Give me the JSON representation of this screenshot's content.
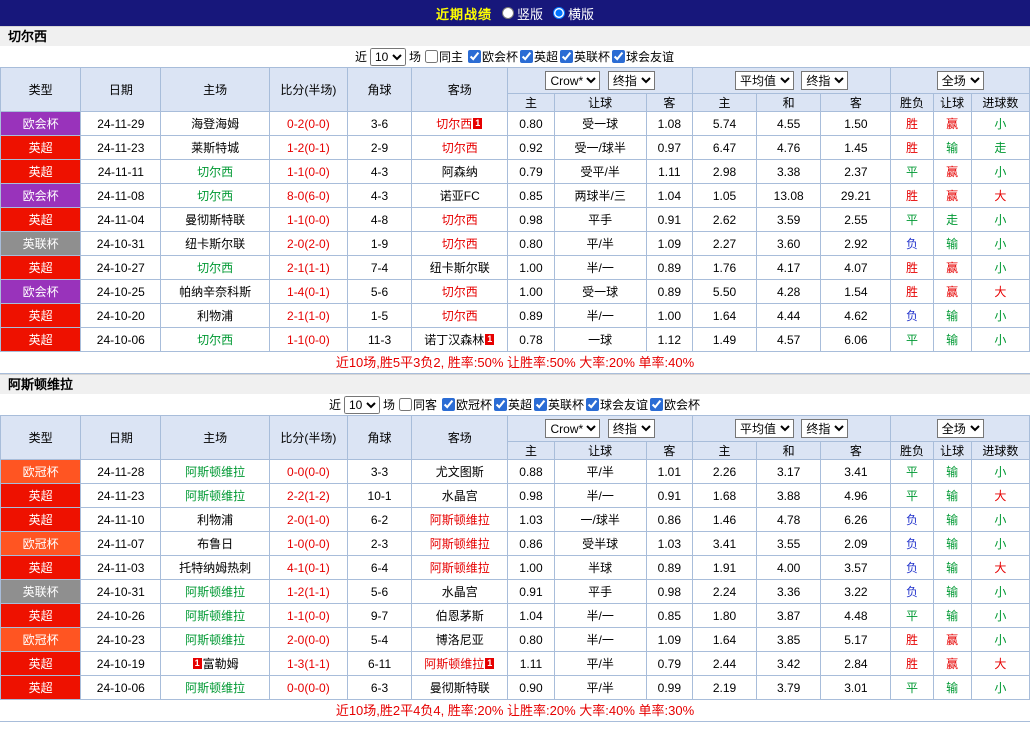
{
  "topbar": {
    "title": "近期战绩",
    "options": [
      {
        "label": "竖版",
        "checked": false
      },
      {
        "label": "横版",
        "checked": true
      }
    ]
  },
  "headers": {
    "type": "类型",
    "date": "日期",
    "home": "主场",
    "score": "比分(半场)",
    "corner": "角球",
    "away": "客场",
    "sub": [
      "主",
      "让球",
      "客",
      "主",
      "和",
      "客",
      "胜负",
      "让球",
      "进球数"
    ],
    "sel_crown": "Crow*",
    "sel_final": "终指",
    "sel_avg": "平均值",
    "sel_final2": "终指",
    "sel_full": "全场"
  },
  "colors": {
    "focus_home": "#009933",
    "focus_away": "#e60000",
    "score": "#e60000",
    "type_colors": {
      "欧会杯": "#9933bb",
      "英超": "#ee1100",
      "英联杯": "#8f8f8f",
      "欧冠杯": "#ff5522"
    },
    "result_colors": {
      "胜": "#e60000",
      "赢": "#e60000",
      "大": "#e60000",
      "平": "#009933",
      "输": "#009933",
      "小": "#009933",
      "走": "#009933",
      "负": "#2233cc"
    }
  },
  "sections": [
    {
      "team": "切尔西",
      "filter": {
        "near": "近",
        "count": "10",
        "games": "场",
        "same": {
          "label": "同主",
          "checked": false
        },
        "leagues": [
          {
            "label": "欧会杯",
            "checked": true
          },
          {
            "label": "英超",
            "checked": true
          },
          {
            "label": "英联杯",
            "checked": true
          },
          {
            "label": "球会友谊",
            "checked": true
          }
        ]
      },
      "rows": [
        {
          "type": "欧会杯",
          "date": "24-11-29",
          "home": "海登海姆",
          "homeMark": "",
          "homeBadge": "",
          "homeBadgePre": "",
          "score": "0-2(0-0)",
          "corner": "3-6",
          "away": "切尔西",
          "awayMark": "away",
          "awayBadge": "1",
          "awayBadgePre": "",
          "o1": "0.80",
          "line": "受一球",
          "o2": "1.08",
          "a1": "5.74",
          "a2": "4.55",
          "a3": "1.50",
          "r1": "胜",
          "r2": "赢",
          "r3": "小"
        },
        {
          "type": "英超",
          "date": "24-11-23",
          "home": "莱斯特城",
          "homeMark": "",
          "homeBadge": "",
          "homeBadgePre": "",
          "score": "1-2(0-1)",
          "corner": "2-9",
          "away": "切尔西",
          "awayMark": "away",
          "awayBadge": "",
          "awayBadgePre": "",
          "o1": "0.92",
          "line": "受一/球半",
          "o2": "0.97",
          "a1": "6.47",
          "a2": "4.76",
          "a3": "1.45",
          "r1": "胜",
          "r2": "输",
          "r3": "走"
        },
        {
          "type": "英超",
          "date": "24-11-11",
          "home": "切尔西",
          "homeMark": "home",
          "homeBadge": "",
          "homeBadgePre": "",
          "score": "1-1(0-0)",
          "corner": "4-3",
          "away": "阿森纳",
          "awayMark": "",
          "awayBadge": "",
          "awayBadgePre": "",
          "o1": "0.79",
          "line": "受平/半",
          "o2": "1.11",
          "a1": "2.98",
          "a2": "3.38",
          "a3": "2.37",
          "r1": "平",
          "r2": "赢",
          "r3": "小"
        },
        {
          "type": "欧会杯",
          "date": "24-11-08",
          "home": "切尔西",
          "homeMark": "home",
          "homeBadge": "",
          "homeBadgePre": "",
          "score": "8-0(6-0)",
          "corner": "4-3",
          "away": "诺亚FC",
          "awayMark": "",
          "awayBadge": "",
          "awayBadgePre": "",
          "o1": "0.85",
          "line": "两球半/三",
          "o2": "1.04",
          "a1": "1.05",
          "a2": "13.08",
          "a3": "29.21",
          "r1": "胜",
          "r2": "赢",
          "r3": "大"
        },
        {
          "type": "英超",
          "date": "24-11-04",
          "home": "曼彻斯特联",
          "homeMark": "",
          "homeBadge": "",
          "homeBadgePre": "",
          "score": "1-1(0-0)",
          "corner": "4-8",
          "away": "切尔西",
          "awayMark": "away",
          "awayBadge": "",
          "awayBadgePre": "",
          "o1": "0.98",
          "line": "平手",
          "o2": "0.91",
          "a1": "2.62",
          "a2": "3.59",
          "a3": "2.55",
          "r1": "平",
          "r2": "走",
          "r3": "小"
        },
        {
          "type": "英联杯",
          "date": "24-10-31",
          "home": "纽卡斯尔联",
          "homeMark": "",
          "homeBadge": "",
          "homeBadgePre": "",
          "score": "2-0(2-0)",
          "corner": "1-9",
          "away": "切尔西",
          "awayMark": "away",
          "awayBadge": "",
          "awayBadgePre": "",
          "o1": "0.80",
          "line": "平/半",
          "o2": "1.09",
          "a1": "2.27",
          "a2": "3.60",
          "a3": "2.92",
          "r1": "负",
          "r2": "输",
          "r3": "小"
        },
        {
          "type": "英超",
          "date": "24-10-27",
          "home": "切尔西",
          "homeMark": "home",
          "homeBadge": "",
          "homeBadgePre": "",
          "score": "2-1(1-1)",
          "corner": "7-4",
          "away": "纽卡斯尔联",
          "awayMark": "",
          "awayBadge": "",
          "awayBadgePre": "",
          "o1": "1.00",
          "line": "半/一",
          "o2": "0.89",
          "a1": "1.76",
          "a2": "4.17",
          "a3": "4.07",
          "r1": "胜",
          "r2": "赢",
          "r3": "小"
        },
        {
          "type": "欧会杯",
          "date": "24-10-25",
          "home": "帕纳辛奈科斯",
          "homeMark": "",
          "homeBadge": "",
          "homeBadgePre": "",
          "score": "1-4(0-1)",
          "corner": "5-6",
          "away": "切尔西",
          "awayMark": "away",
          "awayBadge": "",
          "awayBadgePre": "",
          "o1": "1.00",
          "line": "受一球",
          "o2": "0.89",
          "a1": "5.50",
          "a2": "4.28",
          "a3": "1.54",
          "r1": "胜",
          "r2": "赢",
          "r3": "大"
        },
        {
          "type": "英超",
          "date": "24-10-20",
          "home": "利物浦",
          "homeMark": "",
          "homeBadge": "",
          "homeBadgePre": "",
          "score": "2-1(1-0)",
          "corner": "1-5",
          "away": "切尔西",
          "awayMark": "away",
          "awayBadge": "",
          "awayBadgePre": "",
          "o1": "0.89",
          "line": "半/一",
          "o2": "1.00",
          "a1": "1.64",
          "a2": "4.44",
          "a3": "4.62",
          "r1": "负",
          "r2": "输",
          "r3": "小"
        },
        {
          "type": "英超",
          "date": "24-10-06",
          "home": "切尔西",
          "homeMark": "home",
          "homeBadge": "",
          "homeBadgePre": "",
          "score": "1-1(0-0)",
          "corner": "11-3",
          "away": "诺丁汉森林",
          "awayMark": "",
          "awayBadge": "1",
          "awayBadgePre": "",
          "o1": "0.78",
          "line": "一球",
          "o2": "1.12",
          "a1": "1.49",
          "a2": "4.57",
          "a3": "6.06",
          "r1": "平",
          "r2": "输",
          "r3": "小"
        }
      ],
      "summary": "近10场,胜5平3负2, 胜率:50% 让胜率:50% 大率:20% 单率:40%"
    },
    {
      "team": "阿斯顿维拉",
      "filter": {
        "near": "近",
        "count": "10",
        "games": "场",
        "same": {
          "label": "同客",
          "checked": false
        },
        "leagues": [
          {
            "label": "欧冠杯",
            "checked": true
          },
          {
            "label": "英超",
            "checked": true
          },
          {
            "label": "英联杯",
            "checked": true
          },
          {
            "label": "球会友谊",
            "checked": true
          },
          {
            "label": "欧会杯",
            "checked": true
          }
        ]
      },
      "rows": [
        {
          "type": "欧冠杯",
          "date": "24-11-28",
          "home": "阿斯顿维拉",
          "homeMark": "home",
          "homeBadge": "",
          "homeBadgePre": "",
          "score": "0-0(0-0)",
          "corner": "3-3",
          "away": "尤文图斯",
          "awayMark": "",
          "awayBadge": "",
          "awayBadgePre": "",
          "o1": "0.88",
          "line": "平/半",
          "o2": "1.01",
          "a1": "2.26",
          "a2": "3.17",
          "a3": "3.41",
          "r1": "平",
          "r2": "输",
          "r3": "小"
        },
        {
          "type": "英超",
          "date": "24-11-23",
          "home": "阿斯顿维拉",
          "homeMark": "home",
          "homeBadge": "",
          "homeBadgePre": "",
          "score": "2-2(1-2)",
          "corner": "10-1",
          "away": "水晶宫",
          "awayMark": "",
          "awayBadge": "",
          "awayBadgePre": "",
          "o1": "0.98",
          "line": "半/一",
          "o2": "0.91",
          "a1": "1.68",
          "a2": "3.88",
          "a3": "4.96",
          "r1": "平",
          "r2": "输",
          "r3": "大"
        },
        {
          "type": "英超",
          "date": "24-11-10",
          "home": "利物浦",
          "homeMark": "",
          "homeBadge": "",
          "homeBadgePre": "",
          "score": "2-0(1-0)",
          "corner": "6-2",
          "away": "阿斯顿维拉",
          "awayMark": "away",
          "awayBadge": "",
          "awayBadgePre": "",
          "o1": "1.03",
          "line": "一/球半",
          "o2": "0.86",
          "a1": "1.46",
          "a2": "4.78",
          "a3": "6.26",
          "r1": "负",
          "r2": "输",
          "r3": "小"
        },
        {
          "type": "欧冠杯",
          "date": "24-11-07",
          "home": "布鲁日",
          "homeMark": "",
          "homeBadge": "",
          "homeBadgePre": "",
          "score": "1-0(0-0)",
          "corner": "2-3",
          "away": "阿斯顿维拉",
          "awayMark": "away",
          "awayBadge": "",
          "awayBadgePre": "",
          "o1": "0.86",
          "line": "受半球",
          "o2": "1.03",
          "a1": "3.41",
          "a2": "3.55",
          "a3": "2.09",
          "r1": "负",
          "r2": "输",
          "r3": "小"
        },
        {
          "type": "英超",
          "date": "24-11-03",
          "home": "托特纳姆热刺",
          "homeMark": "",
          "homeBadge": "",
          "homeBadgePre": "",
          "score": "4-1(0-1)",
          "corner": "6-4",
          "away": "阿斯顿维拉",
          "awayMark": "away",
          "awayBadge": "",
          "awayBadgePre": "",
          "o1": "1.00",
          "line": "半球",
          "o2": "0.89",
          "a1": "1.91",
          "a2": "4.00",
          "a3": "3.57",
          "r1": "负",
          "r2": "输",
          "r3": "大"
        },
        {
          "type": "英联杯",
          "date": "24-10-31",
          "home": "阿斯顿维拉",
          "homeMark": "home",
          "homeBadge": "",
          "homeBadgePre": "",
          "score": "1-2(1-1)",
          "corner": "5-6",
          "away": "水晶宫",
          "awayMark": "",
          "awayBadge": "",
          "awayBadgePre": "",
          "o1": "0.91",
          "line": "平手",
          "o2": "0.98",
          "a1": "2.24",
          "a2": "3.36",
          "a3": "3.22",
          "r1": "负",
          "r2": "输",
          "r3": "小"
        },
        {
          "type": "英超",
          "date": "24-10-26",
          "home": "阿斯顿维拉",
          "homeMark": "home",
          "homeBadge": "",
          "homeBadgePre": "",
          "score": "1-1(0-0)",
          "corner": "9-7",
          "away": "伯恩茅斯",
          "awayMark": "",
          "awayBadge": "",
          "awayBadgePre": "",
          "o1": "1.04",
          "line": "半/一",
          "o2": "0.85",
          "a1": "1.80",
          "a2": "3.87",
          "a3": "4.48",
          "r1": "平",
          "r2": "输",
          "r3": "小"
        },
        {
          "type": "欧冠杯",
          "date": "24-10-23",
          "home": "阿斯顿维拉",
          "homeMark": "home",
          "homeBadge": "",
          "homeBadgePre": "",
          "score": "2-0(0-0)",
          "corner": "5-4",
          "away": "博洛尼亚",
          "awayMark": "",
          "awayBadge": "",
          "awayBadgePre": "",
          "o1": "0.80",
          "line": "半/一",
          "o2": "1.09",
          "a1": "1.64",
          "a2": "3.85",
          "a3": "5.17",
          "r1": "胜",
          "r2": "赢",
          "r3": "小"
        },
        {
          "type": "英超",
          "date": "24-10-19",
          "home": "富勒姆",
          "homeMark": "",
          "homeBadge": "",
          "homeBadgePre": "1",
          "score": "1-3(1-1)",
          "corner": "6-11",
          "away": "阿斯顿维拉",
          "awayMark": "away",
          "awayBadge": "1",
          "awayBadgePre": "",
          "o1": "1.11",
          "line": "平/半",
          "o2": "0.79",
          "a1": "2.44",
          "a2": "3.42",
          "a3": "2.84",
          "r1": "胜",
          "r2": "赢",
          "r3": "大"
        },
        {
          "type": "英超",
          "date": "24-10-06",
          "home": "阿斯顿维拉",
          "homeMark": "home",
          "homeBadge": "",
          "homeBadgePre": "",
          "score": "0-0(0-0)",
          "corner": "6-3",
          "away": "曼彻斯特联",
          "awayMark": "",
          "awayBadge": "",
          "awayBadgePre": "",
          "o1": "0.90",
          "line": "平/半",
          "o2": "0.99",
          "a1": "2.19",
          "a2": "3.79",
          "a3": "3.01",
          "r1": "平",
          "r2": "输",
          "r3": "小"
        }
      ],
      "summary": "近10场,胜2平4负4, 胜率:20% 让胜率:20% 大率:40% 单率:30%"
    }
  ]
}
